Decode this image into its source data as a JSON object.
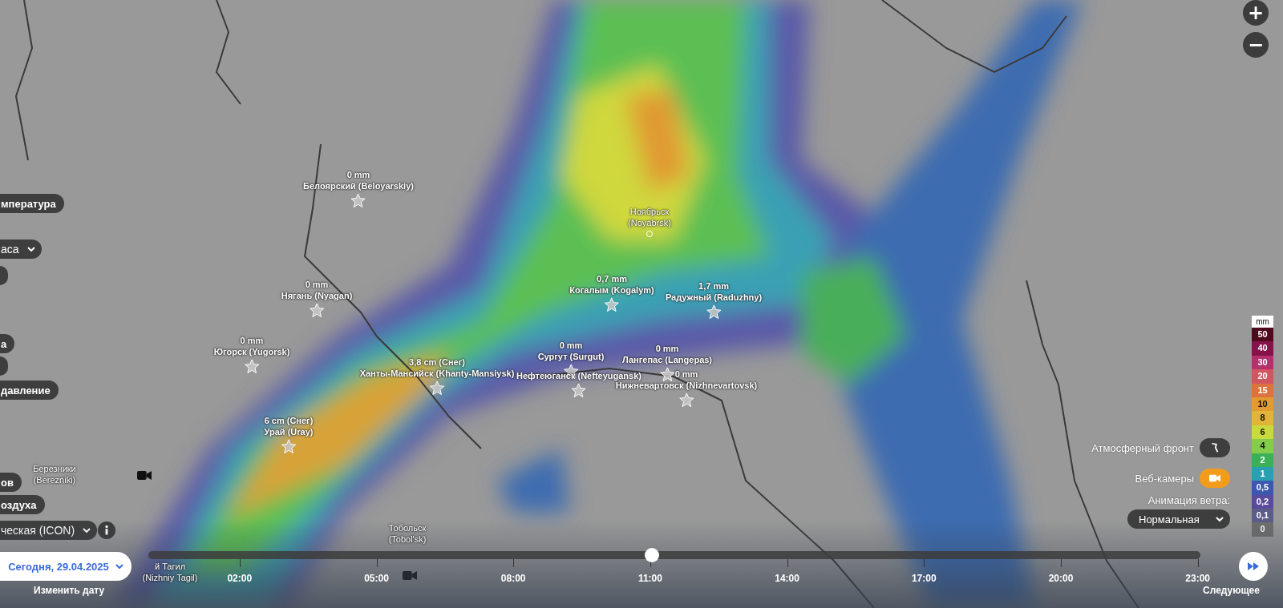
{
  "zoom_controls": [
    "+",
    "−"
  ],
  "cities": [
    {
      "name": "Белоярский (Beloyarskiy)",
      "amount": "0 mm",
      "kind": "star"
    },
    {
      "name": "Ноябрьск (Noyabrsk)",
      "kind": "dot"
    },
    {
      "name": "Нягань (Nyagan)",
      "amount": "0 mm",
      "kind": "star"
    },
    {
      "name": "Когалым (Kogalym)",
      "amount": "0,7 mm",
      "kind": "star"
    },
    {
      "name": "Радужный (Raduzhny)",
      "amount": "1,7 mm",
      "kind": "star"
    },
    {
      "name": "Югорск (Yugorsk)",
      "amount": "0 mm",
      "kind": "star"
    },
    {
      "name": "Сургут (Surgut)",
      "amount": "0 mm",
      "kind": "star"
    },
    {
      "name": "Лангепас (Langepas)",
      "amount": "0 mm",
      "kind": "star"
    },
    {
      "name": "Ханты-Мансийск (Khanty-Mansiysk)",
      "amount": "3,8 cm (Снег)",
      "kind": "star"
    },
    {
      "name": "Нефтеюганск (Nefteyugansk)",
      "kind": "star"
    },
    {
      "name": "Нижневартовск (Nizhnevartovsk)",
      "amount": "0 mm",
      "kind": "star"
    },
    {
      "name": "Урай (Uray)",
      "amount": "6 cm (Снег)",
      "kind": "star"
    },
    {
      "name": "Березники (Berezniki)",
      "kind": "label"
    },
    {
      "name": "Тобольск (Tobol'sk)",
      "kind": "label"
    },
    {
      "name": "й Тагил (Nizhniy Tagil)",
      "kind": "label"
    }
  ],
  "left_panel": [
    {
      "kind": "pill",
      "label": "мпература"
    },
    {
      "kind": "dropdown",
      "label": "аса"
    },
    {
      "kind": "blank"
    },
    {
      "kind": "pill",
      "label": "а"
    },
    {
      "kind": "blank"
    },
    {
      "kind": "pill",
      "label": "давление"
    },
    {
      "kind": "pill",
      "label": "ов"
    },
    {
      "kind": "pill",
      "label": "оздуха"
    },
    {
      "kind": "dropdown",
      "label": "ческая (ICON)"
    }
  ],
  "right_panel": {
    "front": {
      "label": "Атмосферный фронт",
      "on": false
    },
    "webcams": {
      "label": "Веб-камеры",
      "on": true
    },
    "wind_animation": {
      "label": "Анимация ветра:",
      "value": "Нормальная"
    }
  },
  "legend": {
    "unit": "mm",
    "steps": [
      {
        "label": "50",
        "color": "#4e0a1c"
      },
      {
        "label": "40",
        "color": "#86124a"
      },
      {
        "label": "30",
        "color": "#b3326e"
      },
      {
        "label": "20",
        "color": "#d05660"
      },
      {
        "label": "15",
        "color": "#dc723e"
      },
      {
        "label": "10",
        "color": "#e39a30"
      },
      {
        "label": "8",
        "color": "#e2b43a"
      },
      {
        "label": "6",
        "color": "#c9da3c"
      },
      {
        "label": "4",
        "color": "#84cc4c"
      },
      {
        "label": "2",
        "color": "#3cb058"
      },
      {
        "label": "1",
        "color": "#2a9fb2"
      },
      {
        "label": "0,5",
        "color": "#3c58ae"
      },
      {
        "label": "0,2",
        "color": "#5a4a9c"
      },
      {
        "label": "0,1",
        "color": "#5c5c88"
      },
      {
        "label": "0",
        "color": "#6e6e6e"
      }
    ]
  },
  "timeline": {
    "date": "Сегодня, 29.04.2025",
    "change_date": "Изменить дату",
    "ticks": [
      "02:00",
      "05:00",
      "08:00",
      "11:00",
      "14:00",
      "17:00",
      "20:00",
      "23:00"
    ],
    "level": 0.479,
    "next": "Следующее"
  }
}
